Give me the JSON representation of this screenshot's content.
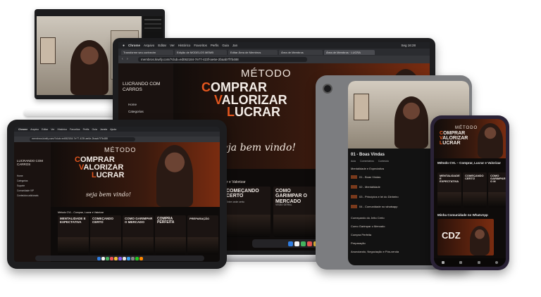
{
  "brand": {
    "accent": "#e4571f",
    "dark": "#0e0b0a"
  },
  "hero": {
    "metodo": "MÉTODO",
    "line1": "OMPRAR",
    "line1_cap": "C",
    "line2": "ALORIZAR",
    "line2_cap": "V",
    "line3": "UCRAR",
    "line3_cap": "L",
    "welcome": "seja bem vindo!"
  },
  "laptop": {
    "menu": [
      "Chrome",
      "Arquivo",
      "Editar",
      "Ver",
      "Histórico",
      "Favoritos",
      "Perfis",
      "Guia",
      "Jan"
    ],
    "clock": "Seg 16:28",
    "tabs": [
      "Transforme seu conhecim",
      "Edição de MODELOS MEMB",
      "Editar Área de Membros",
      "Área de Membros",
      "Área de Membros · LUCRA"
    ],
    "url": "membros.kiwify.com/?club=ed062184-7e77-423f-ae6e-2baab7f7b488",
    "sidebar_title": "LUCRANDO COM CARROS",
    "sidebar_items": [
      "Home",
      "Categorias"
    ],
    "section_heading": "r e Valorizar",
    "cards": [
      {
        "title": "COMEÇANDO CERTO",
        "sub": "Entre onde certo"
      },
      {
        "title": "COMO GARIMPAR O MERCADO",
        "sub": "VISÃO GERAL"
      }
    ]
  },
  "tablet_left": {
    "menu": [
      "Chrome",
      "Arquivo",
      "Editar",
      "Ver",
      "Histórico",
      "Favoritos",
      "Perfis",
      "Guia",
      "Janela",
      "Ajuda"
    ],
    "url": "membros.kiwify.com/?club=ed062184-7e77-423f-ae6e-2baab7f7b488",
    "sidebar_title": "LUCRANDO COM CARROS",
    "sidebar_items": [
      "Home",
      "Categorias",
      "Suporte",
      "Comunidade VIP",
      "Conteúdos adicionais"
    ],
    "section_heading": "Método CVL - Comprar, Lucrar e Valorizar",
    "cards": [
      {
        "title": "MENTALIDADE E EXPECTATIVA",
        "sub": ""
      },
      {
        "title": "COMEÇANDO CERTO",
        "sub": ""
      },
      {
        "title": "COMO GARIMPAR O MERCADO",
        "sub": ""
      },
      {
        "title": "COMPRA PERFEITA",
        "sub": ""
      },
      {
        "title": "PREPARAÇÃO",
        "sub": ""
      }
    ]
  },
  "tablet_right": {
    "lesson_title": "01 - Boas Vindas",
    "tabs": [
      "Aula",
      "Comentários",
      "Conteúdo"
    ],
    "modules": [
      "Mentalidade e Expectativa",
      "01 - Boas Vindas",
      "02 - Mentalidade",
      "03 - Princípios e lei do Dinheiro",
      "04 - Comunidade no whatsapp",
      "Começando do Jeito Certo",
      "Como Garimpar o Mercado",
      "Compra Perfeita",
      "Preparação",
      "Anunciando, Negociação e Pós-venda"
    ]
  },
  "phone": {
    "metodo": "MÉTODO",
    "course_title": "Método CVL – Comprar, Lucrar e Valorizar",
    "cards": [
      {
        "title": "MENTALIDADE E EXPECTATIVA"
      },
      {
        "title": "COMEÇANDO CERTO"
      },
      {
        "title": "COMO GARIMPAR O M"
      }
    ],
    "community_title": "Minha Comunidade no WhatsApp",
    "cdz": "CDZ"
  },
  "icons": [
    "apple-icon",
    "wifi-icon",
    "battery-icon",
    "home-icon",
    "grid-icon",
    "play-icon",
    "camera-icon",
    "user-icon"
  ]
}
